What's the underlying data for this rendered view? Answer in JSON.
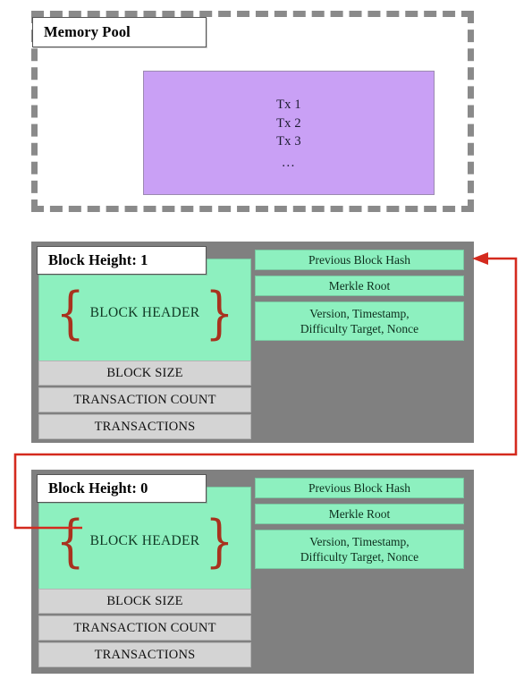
{
  "mempool": {
    "title": "Memory Pool",
    "transactions": [
      "Tx 1",
      "Tx 2",
      "Tx 3",
      "..."
    ],
    "box_color": "#c9a0f5"
  },
  "blocks": [
    {
      "label": "Block Height: 1",
      "header_text": "BLOCK HEADER",
      "brace_left": "{",
      "brace_right": "}",
      "fields": {
        "previous_block_hash": "Previous Block Hash",
        "merkle_root": "Merkle Root",
        "version_line_1": "Version, Timestamp,",
        "version_line_2": "Difficulty Target, Nonce"
      },
      "rows": [
        "BLOCK SIZE",
        "TRANSACTION COUNT",
        "TRANSACTIONS"
      ]
    },
    {
      "label": "Block Height: 0",
      "header_text": "BLOCK HEADER",
      "brace_left": "{",
      "brace_right": "}",
      "fields": {
        "previous_block_hash": "Previous Block Hash",
        "merkle_root": "Merkle Root",
        "version_line_1": "Version, Timestamp,",
        "version_line_2": "Difficulty Target, Nonce"
      },
      "rows": [
        "BLOCK SIZE",
        "TRANSACTION COUNT",
        "TRANSACTIONS"
      ]
    }
  ],
  "colors": {
    "block_background": "#808080",
    "header_green": "#8df0bf",
    "row_gray": "#d4d4d4",
    "mempool_purple": "#c9a0f5",
    "connector_red": "#d42a1e",
    "brace_red": "#a8321e",
    "dashed_border": "#8a8a8a"
  },
  "connector": {
    "description": "arrow from block 0 header to block 1 previous block hash"
  }
}
